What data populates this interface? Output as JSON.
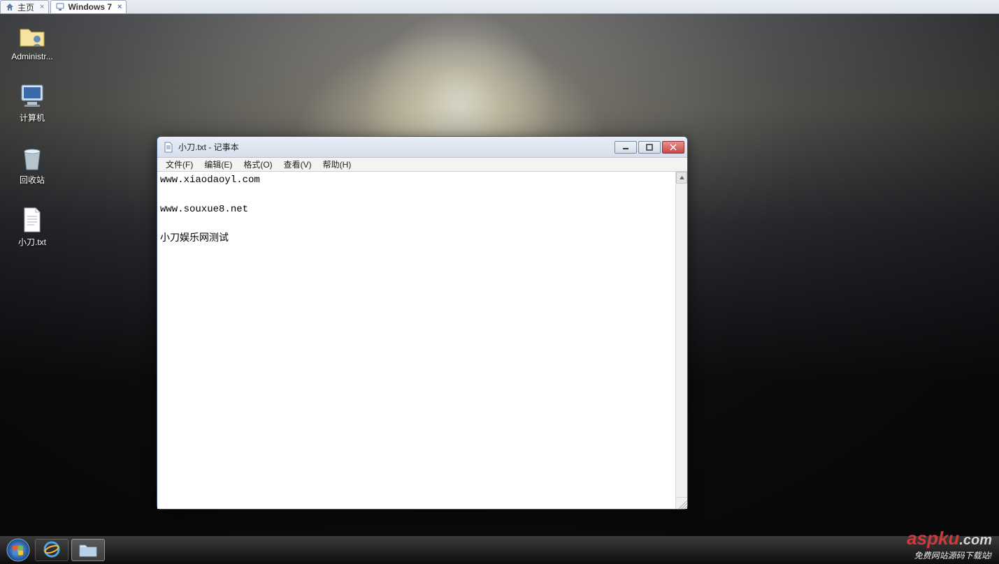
{
  "tabs": [
    {
      "label": "主页",
      "active": false,
      "icon": "home-icon"
    },
    {
      "label": "Windows 7",
      "active": true,
      "icon": "monitor-icon"
    }
  ],
  "desktop_icons": [
    {
      "name": "admin-folder",
      "label": "Administr...",
      "icon": "folder-user-icon"
    },
    {
      "name": "computer",
      "label": "计算机",
      "icon": "computer-icon"
    },
    {
      "name": "recycle-bin",
      "label": "回收站",
      "icon": "recycle-bin-icon"
    },
    {
      "name": "txt-file",
      "label": "小刀.txt",
      "icon": "text-file-icon"
    }
  ],
  "notepad": {
    "title": "小刀.txt - 记事本",
    "menu": {
      "file": "文件(F)",
      "edit": "编辑(E)",
      "format": "格式(O)",
      "view": "查看(V)",
      "help": "帮助(H)"
    },
    "content": "www.xiaodaoyl.com\n\nwww.souxue8.net\n\n小刀娱乐网测试"
  },
  "taskbar": {
    "items": [
      {
        "name": "ie",
        "icon": "ie-icon",
        "active": false
      },
      {
        "name": "explorer",
        "icon": "folder-icon",
        "active": true
      }
    ]
  },
  "watermark": {
    "brand_main": "aspku",
    "brand_tld": ".com",
    "sub": "免费网站源码下载站!"
  }
}
